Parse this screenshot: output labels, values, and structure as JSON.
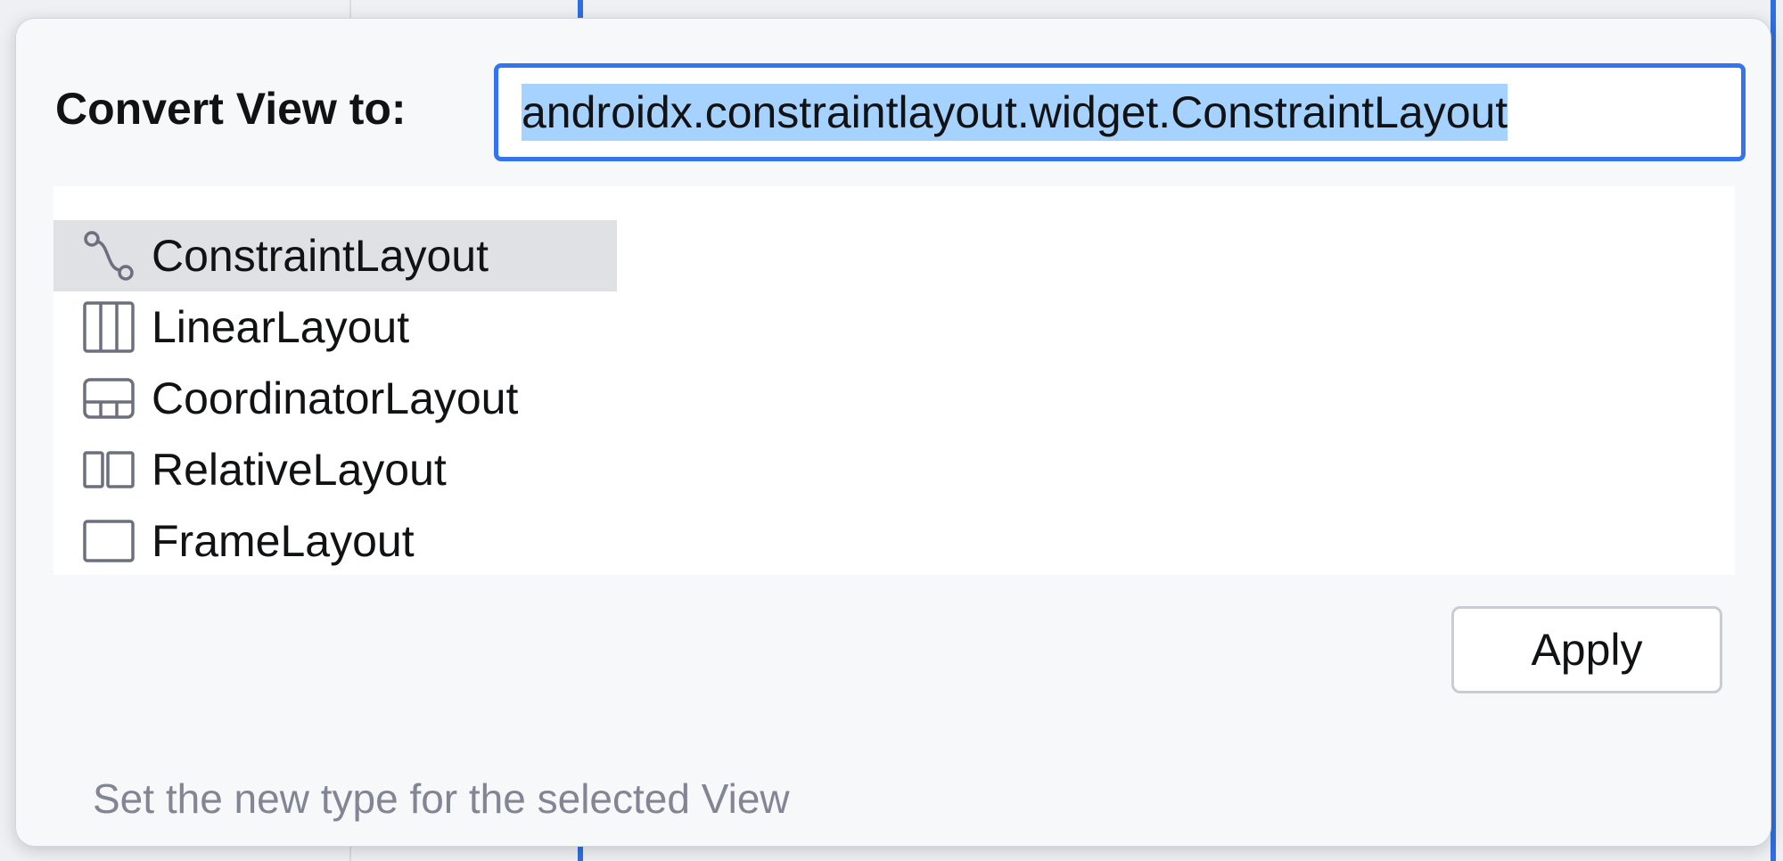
{
  "dialog": {
    "label": "Convert View to:",
    "input_value": "androidx.constraintlayout.widget.ConstraintLayout",
    "apply_label": "Apply",
    "hint": "Set the new type for the selected View"
  },
  "list": {
    "items": [
      {
        "label": "ConstraintLayout",
        "icon": "constraint-layout-icon",
        "selected": true
      },
      {
        "label": "LinearLayout",
        "icon": "linear-layout-icon",
        "selected": false
      },
      {
        "label": "CoordinatorLayout",
        "icon": "coordinator-layout-icon",
        "selected": false
      },
      {
        "label": "RelativeLayout",
        "icon": "relative-layout-icon",
        "selected": false
      },
      {
        "label": "FrameLayout",
        "icon": "frame-layout-icon",
        "selected": false
      }
    ]
  },
  "colors": {
    "accent": "#3574f0",
    "selection_highlight": "#a6d2ff",
    "selected_row": "#dfe1e5",
    "hint_text": "#818594",
    "icon_stroke": "#6c707e"
  }
}
